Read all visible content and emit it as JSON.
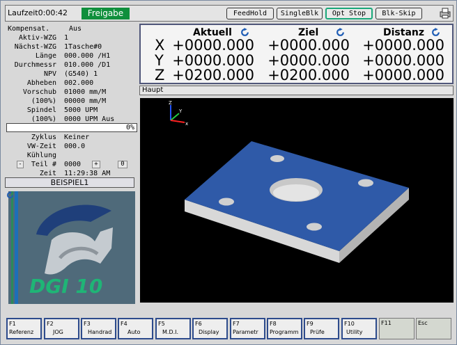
{
  "topbar": {
    "runtime": "Laufzeit0:00:42",
    "status": "Freigabe",
    "buttons": [
      {
        "label": "FeedHold"
      },
      {
        "label": "SingleBlk"
      },
      {
        "label": "Opt Stop"
      },
      {
        "label": "Blk-Skip"
      }
    ]
  },
  "left": {
    "rows": [
      {
        "label": "Kompensat.",
        "value": "Aus"
      },
      {
        "label": "Aktiv-WZG",
        "value": "1"
      },
      {
        "label": "Nächst-WZG",
        "value": "1Tasche#0"
      },
      {
        "label": "Länge",
        "value": "000.000 /H1"
      },
      {
        "label": "Durchmessr",
        "value": "010.000 /D1"
      },
      {
        "label": "NPV",
        "value": "(G540) 1"
      },
      {
        "label": "Abheben",
        "value": "002.000"
      },
      {
        "label": "Vorschub",
        "value": "01000 mm/M"
      },
      {
        "label": "(100%)",
        "value": "00000 mm/M"
      },
      {
        "label": "Spindel",
        "value": "5000 UPM"
      },
      {
        "label": "(100%)",
        "value": "0000 UPM Aus"
      }
    ],
    "progress": {
      "value": 0,
      "text": "0%"
    },
    "rows2": [
      {
        "label": "Zyklus",
        "value": "Keiner"
      },
      {
        "label": "VW-Zeit",
        "value": "000.0"
      },
      {
        "label": "Kühlung",
        "value": ""
      }
    ],
    "teil": {
      "minus": "-",
      "label": "Teil #",
      "value": "0000",
      "plus": "+",
      "count": "0"
    },
    "zeit": {
      "label": "Zeit",
      "value": "11:29:38 AM"
    },
    "program": "BEISPIEL1"
  },
  "logo": {
    "text": "DGI 10"
  },
  "dro": {
    "headers": [
      "Aktuell",
      "Ziel",
      "Distanz"
    ],
    "axes": [
      {
        "name": "X",
        "aktuell": "+0000.000",
        "ziel": "+0000.000",
        "distanz": "+0000.000"
      },
      {
        "name": "Y",
        "aktuell": "+0000.000",
        "ziel": "+0000.000",
        "distanz": "+0000.000"
      },
      {
        "name": "Z",
        "aktuell": "+0200.000",
        "ziel": "+0200.000",
        "distanz": "+0000.000"
      }
    ]
  },
  "view": {
    "title": "Haupt",
    "triad": {
      "x": "x",
      "y": "Y",
      "z": "Z"
    }
  },
  "fkeys": [
    {
      "fn": "F1",
      "label": "Referenz"
    },
    {
      "fn": "F2",
      "label": "JOG"
    },
    {
      "fn": "F3",
      "label": "Handrad"
    },
    {
      "fn": "F4",
      "label": "Auto"
    },
    {
      "fn": "F5",
      "label": "M.D.I."
    },
    {
      "fn": "F6",
      "label": "Display"
    },
    {
      "fn": "F7",
      "label": "Parametr"
    },
    {
      "fn": "F8",
      "label": "Programm"
    },
    {
      "fn": "F9",
      "label": "Prüfe"
    },
    {
      "fn": "F10",
      "label": "Utility"
    },
    {
      "fn": "F11",
      "label": ""
    },
    {
      "fn": "Esc",
      "label": ""
    }
  ],
  "colors": {
    "accent": "#0f8f3c",
    "part_top": "#2f5aa8",
    "fkey_border": "#2d4b8c"
  }
}
